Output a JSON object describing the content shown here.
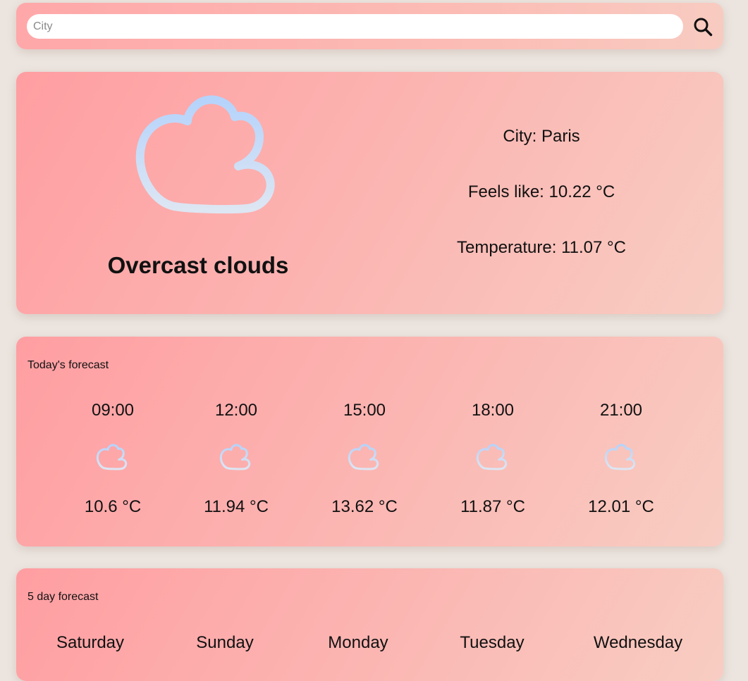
{
  "search": {
    "placeholder": "City",
    "value": "",
    "button_icon": "search-icon"
  },
  "current": {
    "icon": "cloud-icon",
    "description": "Overcast clouds",
    "city_line": "City: Paris",
    "feels_like_line": "Feels like: 10.22 °C",
    "temperature_line": "Temperature: 11.07 °C"
  },
  "today": {
    "title": "Today's forecast",
    "items": [
      {
        "time": "09:00",
        "temp": "10.6 °C",
        "icon": "cloud-icon"
      },
      {
        "time": "12:00",
        "temp": "11.94 °C",
        "icon": "cloud-icon"
      },
      {
        "time": "15:00",
        "temp": "13.62 °C",
        "icon": "cloud-icon"
      },
      {
        "time": "18:00",
        "temp": "11.87 °C",
        "icon": "cloud-icon"
      },
      {
        "time": "21:00",
        "temp": "12.01 °C",
        "icon": "cloud-icon"
      }
    ]
  },
  "five_day": {
    "title": "5 day forecast",
    "days": [
      "Saturday",
      "Sunday",
      "Monday",
      "Tuesday",
      "Wednesday"
    ]
  },
  "colors": {
    "card_start": "#ff9ea2",
    "card_end": "#f8cdc2",
    "icon_start": "#b5d3fb",
    "icon_end": "#dde6f3"
  }
}
